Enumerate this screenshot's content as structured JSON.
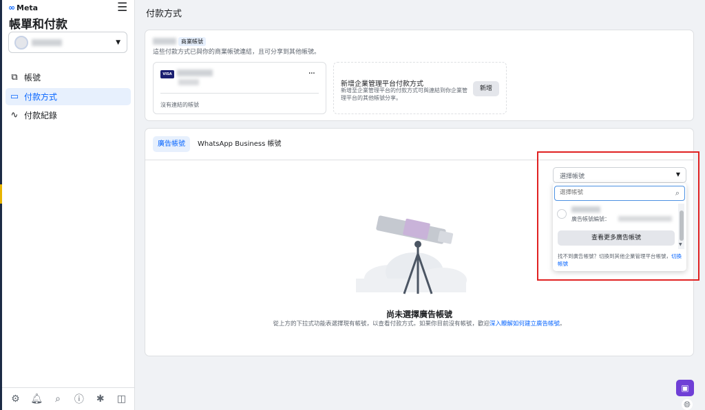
{
  "brand": {
    "name": "Meta",
    "logo_icon": "meta-infinity-icon"
  },
  "sidebar": {
    "title": "帳單和付款",
    "account_selector": {
      "name": "",
      "caret_icon": "caret-down-icon"
    },
    "items": [
      {
        "label": "帳號",
        "icon": "accounts-icon",
        "active": false
      },
      {
        "label": "付款方式",
        "icon": "credit-card-icon",
        "active": true
      },
      {
        "label": "付款紀錄",
        "icon": "activity-icon",
        "active": false
      }
    ],
    "bottom_icons": [
      "gear-icon",
      "bell-icon",
      "search-icon",
      "help-icon",
      "bug-icon",
      "panel-toggle-icon"
    ]
  },
  "page": {
    "title": "付款方式",
    "business": {
      "badge": "商業帳號",
      "description": "這些付款方式已與你的商業帳號連結，且可分享到其他帳號。"
    },
    "payment_method": {
      "card_brand": "VISA",
      "more": "···",
      "note": "沒有連結的帳號"
    },
    "add_method": {
      "title": "新增企業管理平台付款方式",
      "description": "新增至企業管理平台的付款方式可與連結到你企業管理平台的其他帳號分享。",
      "button": "新增"
    },
    "tabs": [
      {
        "label": "廣告帳號",
        "active": true
      },
      {
        "label": "WhatsApp Business 帳號",
        "active": false
      }
    ],
    "empty_state": {
      "title": "尚未選擇廣告帳號",
      "description": "從上方的下拉式功能表選擇現有帳號，以查看付款方式。如果你目前沒有帳號，歡迎",
      "link": "深入瞭解如何建立廣告帳號",
      "suffix": "。"
    },
    "dropdown": {
      "placeholder": "選擇帳號",
      "search_placeholder": "選擇帳號",
      "item_id_label": "廣告帳號編號：",
      "see_more": "查看更多廣告帳號",
      "footer_text": "找不到廣告帳號？切換到其他企業管理平台帳號，",
      "footer_link": "切換帳號"
    }
  },
  "colors": {
    "accent": "#0866ff",
    "highlight_box": "#e02020",
    "chat": "#6f3fd6"
  }
}
